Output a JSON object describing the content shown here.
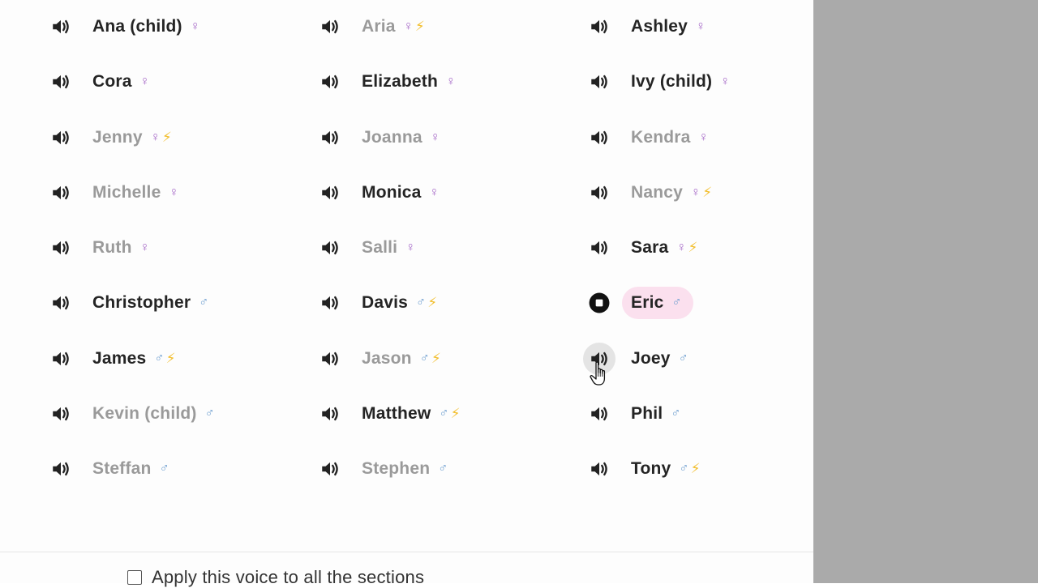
{
  "voices": [
    {
      "name": "Ana (child)",
      "gender": "female",
      "neural": false,
      "available": true
    },
    {
      "name": "Aria",
      "gender": "female",
      "neural": true,
      "available": false
    },
    {
      "name": "Ashley",
      "gender": "female",
      "neural": false,
      "available": true
    },
    {
      "name": "Cora",
      "gender": "female",
      "neural": false,
      "available": true
    },
    {
      "name": "Elizabeth",
      "gender": "female",
      "neural": false,
      "available": true
    },
    {
      "name": "Ivy (child)",
      "gender": "female",
      "neural": false,
      "available": true
    },
    {
      "name": "Jenny",
      "gender": "female",
      "neural": true,
      "available": false
    },
    {
      "name": "Joanna",
      "gender": "female",
      "neural": false,
      "available": false
    },
    {
      "name": "Kendra",
      "gender": "female",
      "neural": false,
      "available": false
    },
    {
      "name": "Michelle",
      "gender": "female",
      "neural": false,
      "available": false
    },
    {
      "name": "Monica",
      "gender": "female",
      "neural": false,
      "available": true
    },
    {
      "name": "Nancy",
      "gender": "female",
      "neural": true,
      "available": false
    },
    {
      "name": "Ruth",
      "gender": "female",
      "neural": false,
      "available": false
    },
    {
      "name": "Salli",
      "gender": "female",
      "neural": false,
      "available": false
    },
    {
      "name": "Sara",
      "gender": "female",
      "neural": true,
      "available": true
    },
    {
      "name": "Christopher",
      "gender": "male",
      "neural": false,
      "available": true
    },
    {
      "name": "Davis",
      "gender": "male",
      "neural": true,
      "available": true
    },
    {
      "name": "Eric",
      "gender": "male",
      "neural": false,
      "available": true,
      "selected": true,
      "playing": true
    },
    {
      "name": "James",
      "gender": "male",
      "neural": true,
      "available": true
    },
    {
      "name": "Jason",
      "gender": "male",
      "neural": true,
      "available": false
    },
    {
      "name": "Joey",
      "gender": "male",
      "neural": false,
      "available": true,
      "hovered": true
    },
    {
      "name": "Kevin (child)",
      "gender": "male",
      "neural": false,
      "available": false
    },
    {
      "name": "Matthew",
      "gender": "male",
      "neural": true,
      "available": true
    },
    {
      "name": "Phil",
      "gender": "male",
      "neural": false,
      "available": true
    },
    {
      "name": "Steffan",
      "gender": "male",
      "neural": false,
      "available": false
    },
    {
      "name": "Stephen",
      "gender": "male",
      "neural": false,
      "available": false
    },
    {
      "name": "Tony",
      "gender": "male",
      "neural": true,
      "available": true
    }
  ],
  "icons": {
    "female_symbol": "♀",
    "male_symbol": "♂",
    "neural_symbol": "⚡"
  },
  "footer": {
    "apply_all_label": "Apply this voice to all the sections",
    "apply_all_checked": false
  },
  "colors": {
    "selected_bg": "#fbe0ee",
    "female": "#a76bc8",
    "male": "#6f9fd0",
    "neural": "#f2bf30",
    "overlay": "#aaaaaa"
  }
}
